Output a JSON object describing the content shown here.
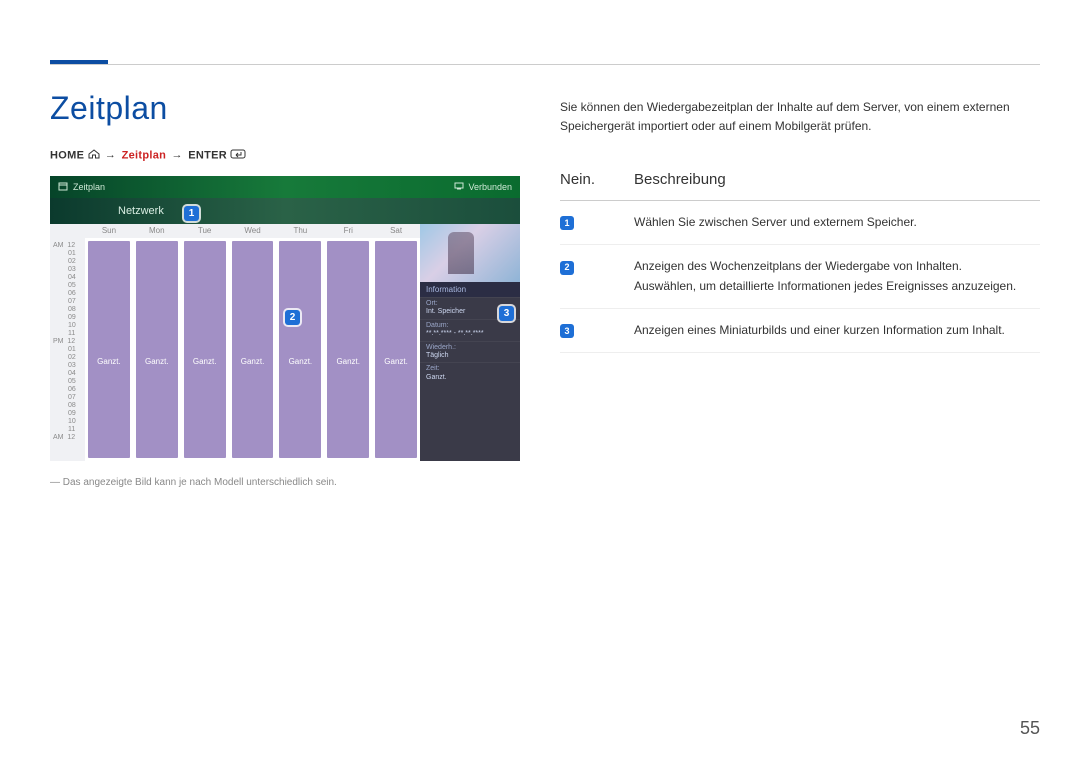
{
  "page_number": "55",
  "title": "Zeitplan",
  "breadcrumb": {
    "home": "HOME",
    "step": "Zeitplan",
    "enter": "ENTER"
  },
  "screenshot": {
    "header_title": "Zeitplan",
    "connected": "Verbunden",
    "network": "Netzwerk",
    "days": [
      "Sun",
      "Mon",
      "Tue",
      "Wed",
      "Thu",
      "Fri",
      "Sat"
    ],
    "block_label": "Ganzt.",
    "time_labels": {
      "am1": "AM",
      "pm": "PM",
      "am2": "AM",
      "hours": [
        "12",
        "01",
        "02",
        "03",
        "04",
        "05",
        "06",
        "07",
        "08",
        "09",
        "10",
        "11"
      ]
    },
    "info": {
      "title": "Information",
      "location_k": "Ort:",
      "location_v": "Int. Speicher",
      "date_k": "Datum:",
      "date_v": "**.**.**** - **.**.****",
      "repeat_k": "Wiederh.:",
      "repeat_v": "Täglich",
      "time_k": "Zeit:",
      "time_v": "Ganzt."
    },
    "callouts": {
      "c1": "1",
      "c2": "2",
      "c3": "3"
    }
  },
  "footnote": "― Das angezeigte Bild kann je nach Modell unterschiedlich sein.",
  "intro": "Sie können den Wiedergabezeitplan der Inhalte auf dem Server, von einem externen Speichergerät importiert oder auf einem Mobilgerät prüfen.",
  "table": {
    "head_no": "Nein.",
    "head_desc": "Beschreibung",
    "rows": [
      {
        "n": "1",
        "desc_a": "Wählen Sie zwischen Server und externem Speicher.",
        "desc_b": ""
      },
      {
        "n": "2",
        "desc_a": "Anzeigen des Wochenzeitplans der Wiedergabe von Inhalten.",
        "desc_b": "Auswählen, um detaillierte Informationen jedes Ereignisses anzuzeigen."
      },
      {
        "n": "3",
        "desc_a": "Anzeigen eines Miniaturbilds und einer kurzen Information zum Inhalt.",
        "desc_b": ""
      }
    ]
  }
}
